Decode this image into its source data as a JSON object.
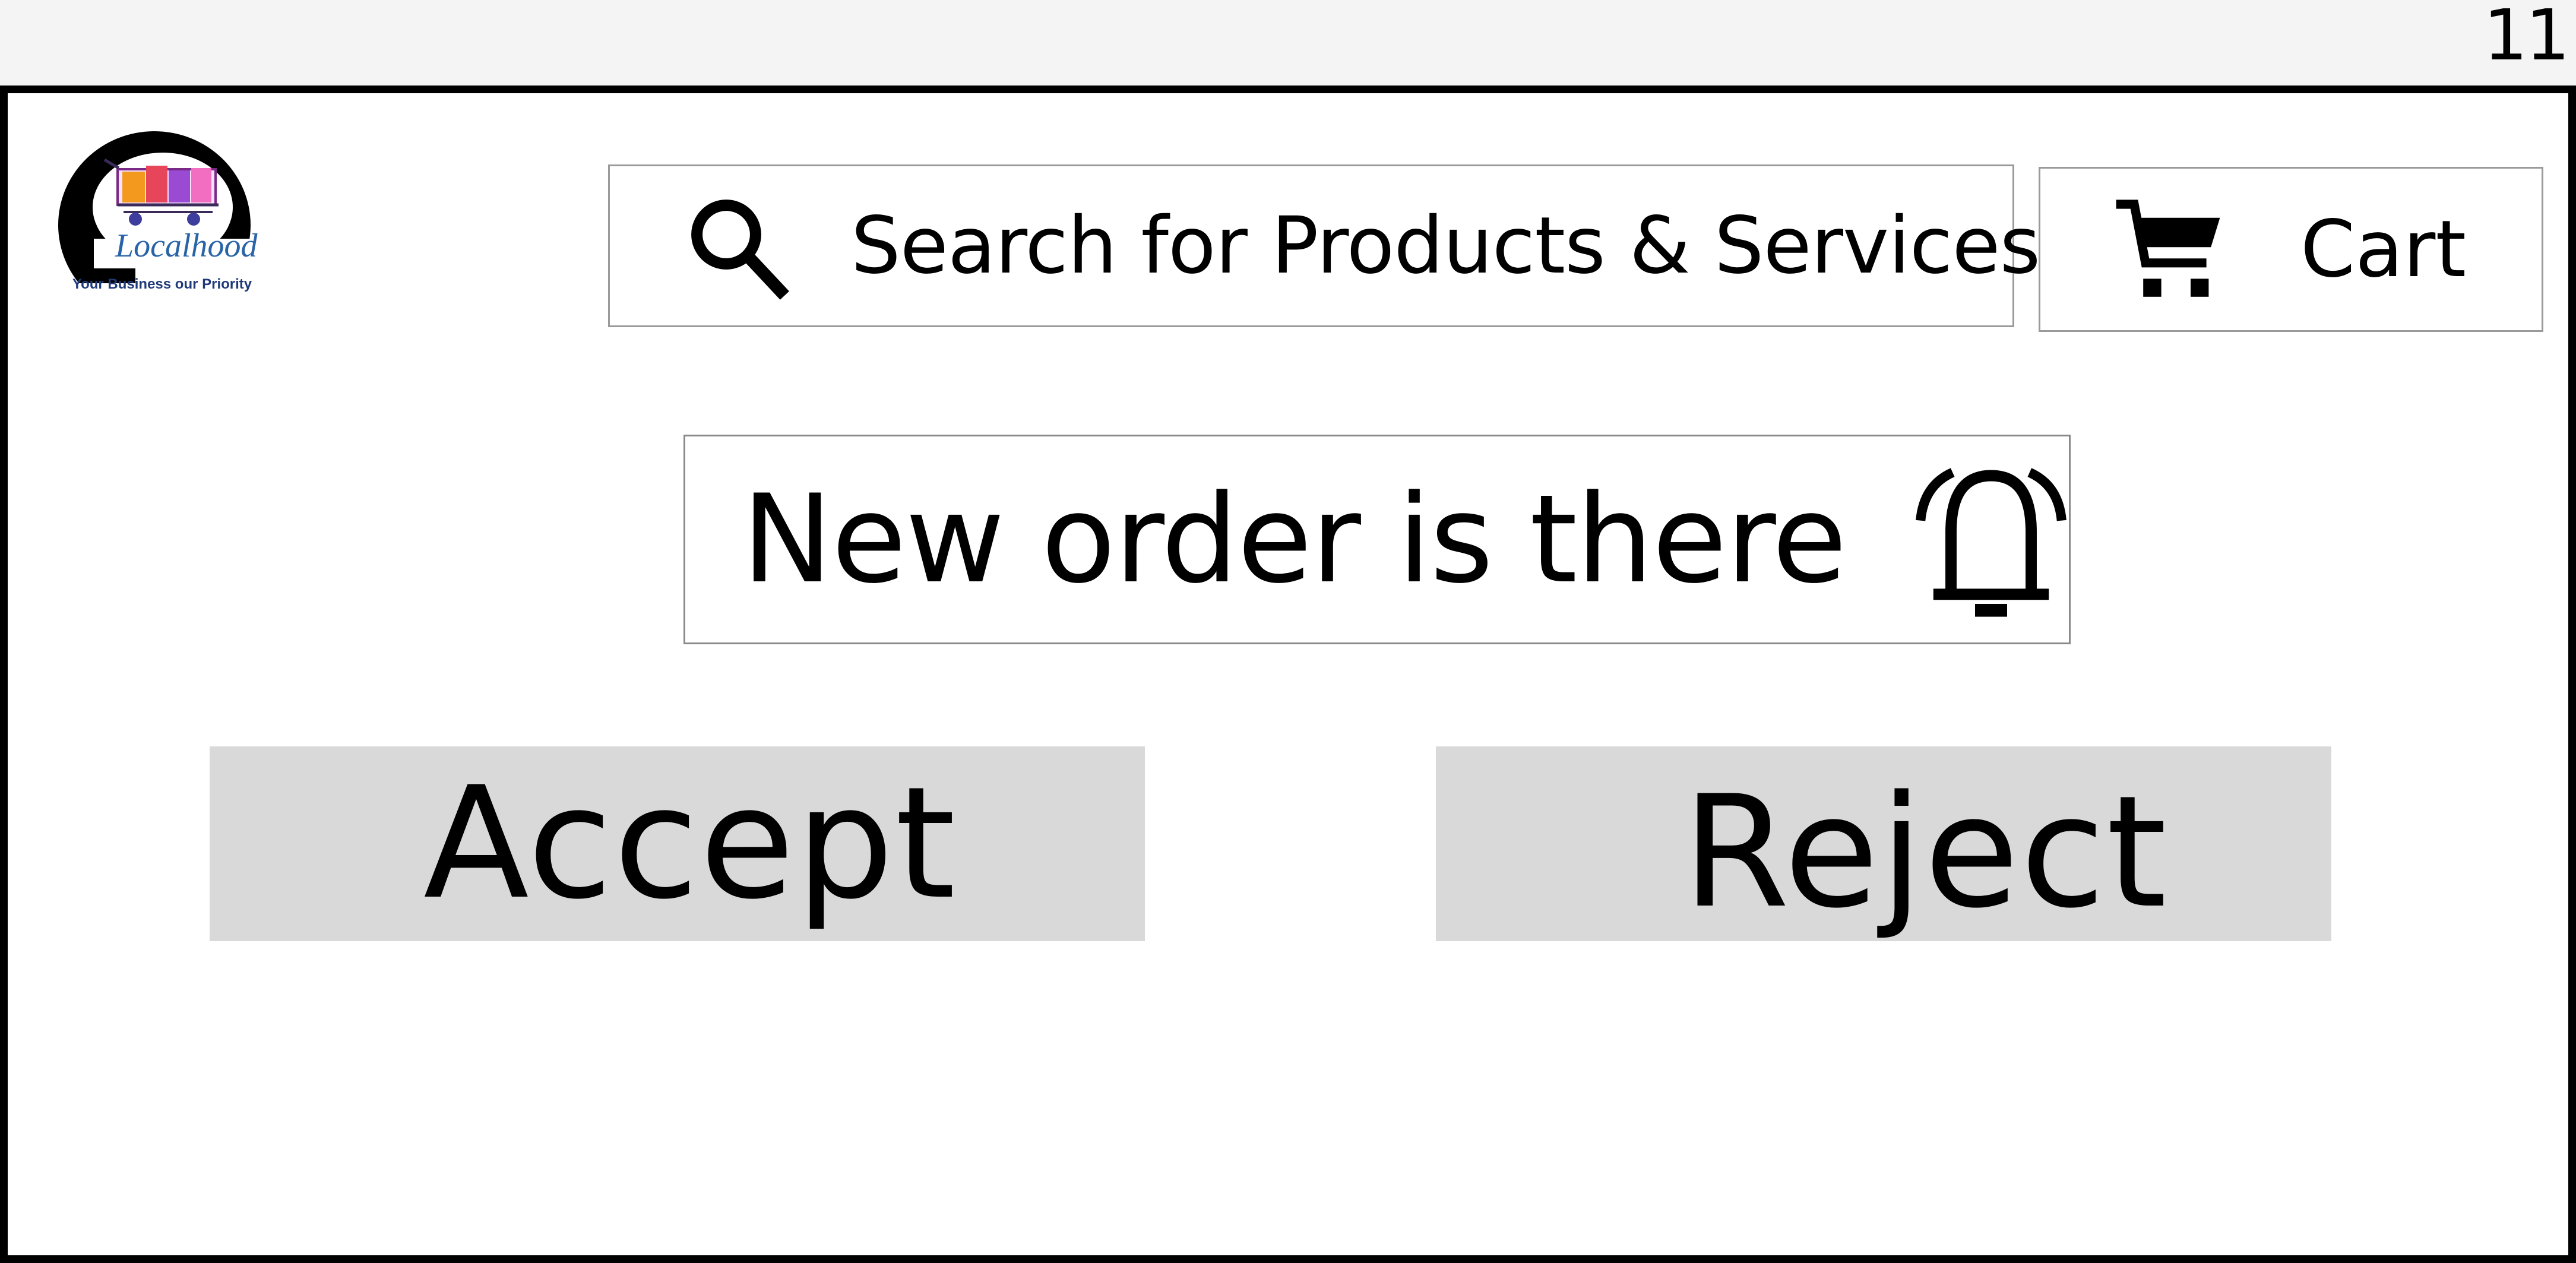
{
  "page_number": "11",
  "logo": {
    "letter": "e",
    "wordmark": "Localhood",
    "tagline": "Your Business our Priority",
    "icon": "shopping-cart-logo"
  },
  "search": {
    "icon": "search-icon",
    "label": "Search for Products & Services"
  },
  "cart": {
    "icon": "cart-icon",
    "label": "Cart"
  },
  "notification": {
    "label": "New order is there",
    "icon": "alarm-bell-icon"
  },
  "actions": {
    "accept_label": "Accept",
    "reject_label": "Reject"
  },
  "colors": {
    "button_bg": "#d9d9d9",
    "frame_border": "#000000",
    "tagline": "#1f3a7a",
    "wordmark": "#2a64a8"
  }
}
